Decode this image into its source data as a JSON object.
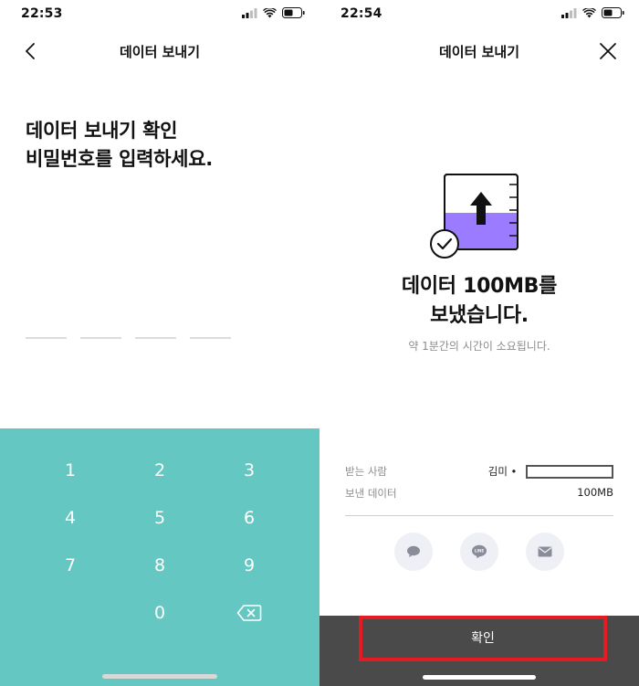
{
  "left_screen": {
    "status": {
      "time": "22:53"
    },
    "nav": {
      "title": "데이터 보내기"
    },
    "headline": {
      "line1": "데이터 보내기 확인",
      "line2": "비밀번호를 입력하세요."
    },
    "pin_length": 4,
    "keypad": {
      "keys": [
        "1",
        "2",
        "3",
        "4",
        "5",
        "6",
        "7",
        "8",
        "9",
        "0"
      ],
      "background": "#64c7c1"
    }
  },
  "right_screen": {
    "status": {
      "time": "22:54"
    },
    "nav": {
      "title": "데이터 보내기"
    },
    "result": {
      "line1": "데이터 100MB를",
      "line2": "보냈습니다."
    },
    "subtitle": "약 1분간의 시간이 소요됩니다.",
    "recipient": {
      "label": "받는 사람",
      "value": "김미 •"
    },
    "data_sent": {
      "label": "보낸 데이터",
      "value": "100MB"
    },
    "confirm_label": "확인",
    "accent": "#9b7bff",
    "highlight": "#e41b23"
  }
}
